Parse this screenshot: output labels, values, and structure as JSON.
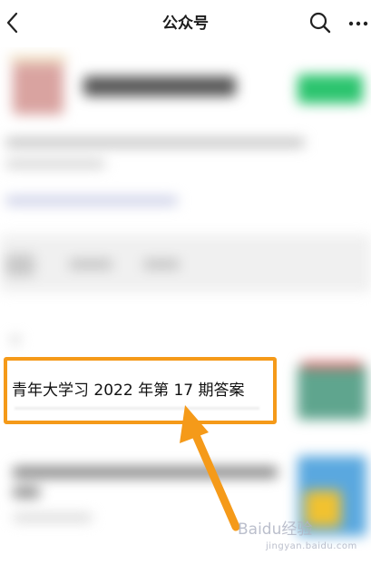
{
  "header": {
    "title": "公众号",
    "back_icon": "chevron-left-icon",
    "search_icon": "search-icon",
    "more_icon": "more-horizontal-icon"
  },
  "highlight": {
    "text": "青年大学习 2022 年第 17 期答案",
    "border_color": "#f59a19"
  },
  "annotation": {
    "arrow_color": "#f59a19"
  },
  "watermark": {
    "text": "Baidu经验",
    "subtext": "jingyan.baidu.com"
  }
}
